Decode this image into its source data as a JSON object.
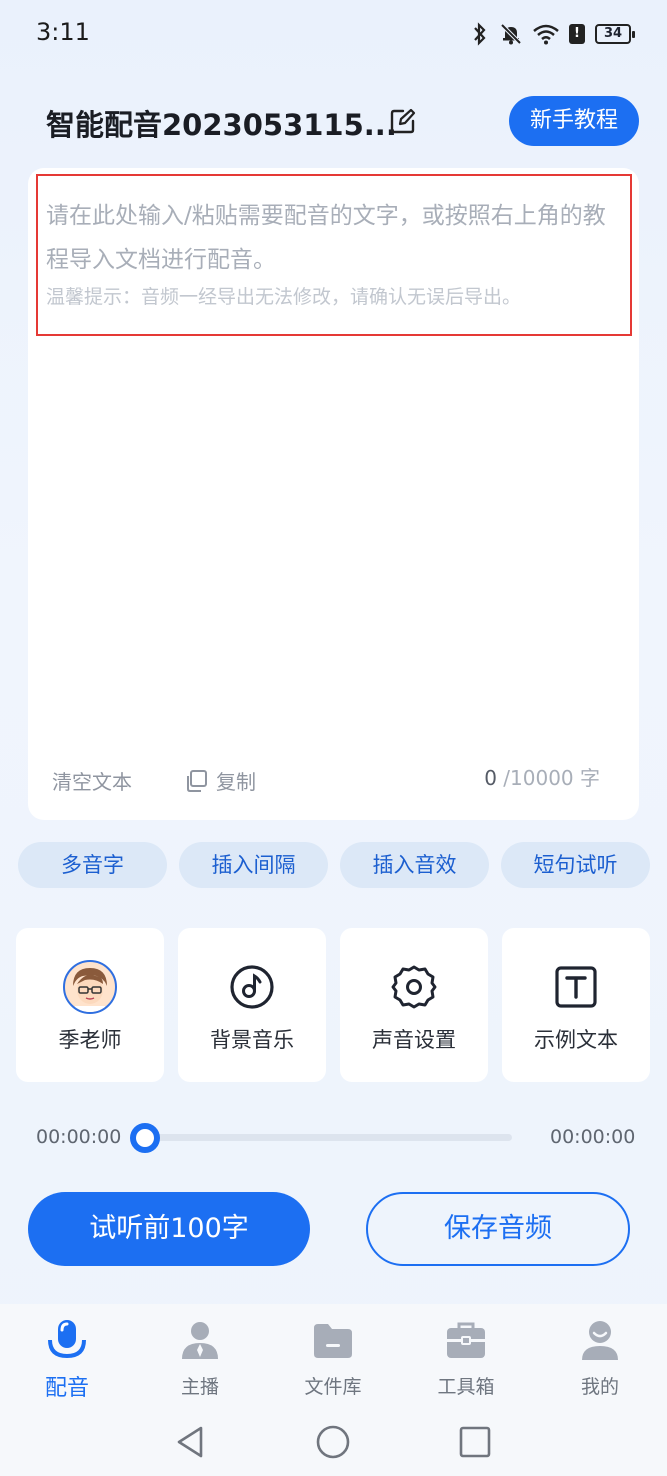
{
  "status_bar": {
    "time": "3:11",
    "battery": "34"
  },
  "header": {
    "title": "智能配音2023053115...",
    "tutorial_label": "新手教程"
  },
  "editor": {
    "placeholder": "请在此处输入/粘贴需要配音的文字，或按照右上角的教程导入文档进行配音。",
    "tip": "温馨提示：音频一经导出无法修改，请确认无误后导出。",
    "clear_label": "清空文本",
    "copy_label": "复制",
    "char_count": "0",
    "char_limit": "/10000 字"
  },
  "chips": [
    "多音字",
    "插入间隔",
    "插入音效",
    "短句试听"
  ],
  "tools": {
    "voice": "季老师",
    "bgm": "背景音乐",
    "settings": "声音设置",
    "sample": "示例文本"
  },
  "player": {
    "current": "00:00:00",
    "total": "00:00:00",
    "progress": 0
  },
  "actions": {
    "preview": "试听前100字",
    "save": "保存音频"
  },
  "tabs": [
    {
      "label": "配音",
      "icon": "mic-icon",
      "active": true
    },
    {
      "label": "主播",
      "icon": "person-icon"
    },
    {
      "label": "文件库",
      "icon": "folder-icon"
    },
    {
      "label": "工具箱",
      "icon": "toolbox-icon"
    },
    {
      "label": "我的",
      "icon": "profile-icon"
    }
  ],
  "colors": {
    "primary": "#1c6ff2",
    "highlight_border": "#e53935"
  }
}
